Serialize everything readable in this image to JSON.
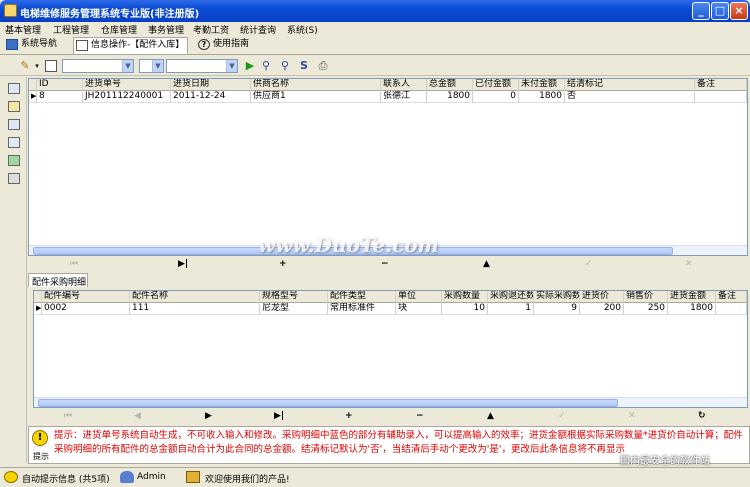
{
  "window": {
    "title": "电梯维修服务管理系统专业版(非注册版)"
  },
  "menu": [
    "基本管理",
    "工程管理",
    "仓库管理",
    "事务管理",
    "考勤工资",
    "统计查询",
    "系统(S)"
  ],
  "tabs": [
    {
      "label": "系统导航"
    },
    {
      "label": "信息操作-【配件入库】"
    },
    {
      "label": "使用指南"
    }
  ],
  "master": {
    "columns": [
      "ID",
      "进货单号",
      "进货日期",
      "供商名称",
      "联系人",
      "总金额",
      "已付金额",
      "未付金额",
      "结清标记",
      "备注"
    ],
    "rows": [
      [
        "8",
        "JH201112240001",
        "2011-12-24",
        "供应商1",
        "张德江",
        "1800",
        "0",
        "1800",
        "否",
        ""
      ]
    ]
  },
  "detail": {
    "tab_label": "配件采购明细",
    "columns": [
      "配件编号",
      "配件名称",
      "规格型号",
      "配件类型",
      "单位",
      "采购数量",
      "采购退还数",
      "实际采购数",
      "进货价",
      "销售价",
      "进货金额",
      "备注"
    ],
    "rows": [
      [
        "0002",
        "111",
        "尼龙型",
        "常用标准件",
        "块",
        "10",
        "1",
        "9",
        "200",
        "250",
        "1800",
        ""
      ]
    ]
  },
  "tip": {
    "label": "提示",
    "text": "提示：进货单号系统自动生成，不可收入输入和修改。采购明细中蓝色的部分有辅助录入，可以提高输入的效率；进货金额根据实际采购数量*进货价自动计算；配件采购明细的所有配件的总金额自动合计为此合同的总金额。结清标记默认为'否'，当结清后手动个更改为'是'，更改后此条信息将不再显示"
  },
  "status": {
    "autotip": "自动提示信息 (共5项)",
    "user": "Admin",
    "welcome": "欢迎使用我们的产品!"
  },
  "watermark": {
    "main": "www.DuoTe.com",
    "corner": "国内最安全的软件站"
  }
}
